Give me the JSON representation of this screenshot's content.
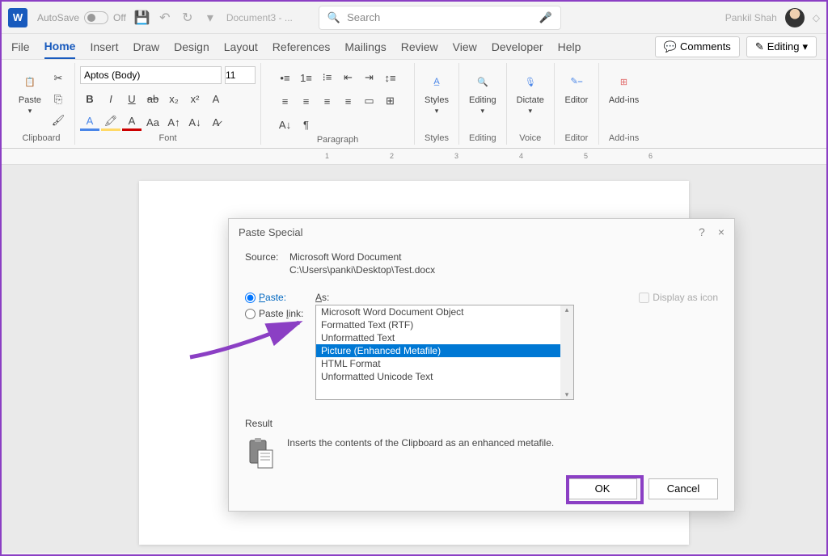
{
  "title_bar": {
    "app_letter": "W",
    "autosave_label": "AutoSave",
    "autosave_state": "Off",
    "doc_name": "Document3 - ...",
    "search_placeholder": "Search",
    "user_name": "Pankil Shah"
  },
  "tabs": {
    "file": "File",
    "home": "Home",
    "insert": "Insert",
    "draw": "Draw",
    "design": "Design",
    "layout": "Layout",
    "references": "References",
    "mailings": "Mailings",
    "review": "Review",
    "view": "View",
    "developer": "Developer",
    "help": "Help",
    "comments": "Comments",
    "editing": "Editing"
  },
  "ribbon": {
    "clipboard": {
      "label": "Clipboard",
      "paste": "Paste"
    },
    "font": {
      "label": "Font",
      "name": "Aptos (Body)",
      "size": "11"
    },
    "paragraph": {
      "label": "Paragraph"
    },
    "styles": {
      "label": "Styles",
      "btn": "Styles"
    },
    "editing": {
      "label": "Editing",
      "btn": "Editing"
    },
    "voice": {
      "label": "Voice",
      "btn": "Dictate"
    },
    "editor": {
      "label": "Editor",
      "btn": "Editor"
    },
    "addins": {
      "label": "Add-ins",
      "btn": "Add-ins"
    }
  },
  "dialog": {
    "title": "Paste Special",
    "help": "?",
    "close": "×",
    "source_label": "Source:",
    "source_name": "Microsoft Word Document",
    "source_path": "C:\\Users\\panki\\Desktop\\Test.docx",
    "paste_label": "Paste:",
    "paste_link_label": "Paste link:",
    "as_label": "As:",
    "items": [
      "Microsoft Word Document Object",
      "Formatted Text (RTF)",
      "Unformatted Text",
      "Picture (Enhanced Metafile)",
      "HTML Format",
      "Unformatted Unicode Text"
    ],
    "display_icon": "Display as icon",
    "result_label": "Result",
    "result_text": "Inserts the contents of the Clipboard as an enhanced metafile.",
    "ok": "OK",
    "cancel": "Cancel"
  },
  "ruler_marks": [
    "1",
    "2",
    "3",
    "4",
    "5",
    "6"
  ]
}
